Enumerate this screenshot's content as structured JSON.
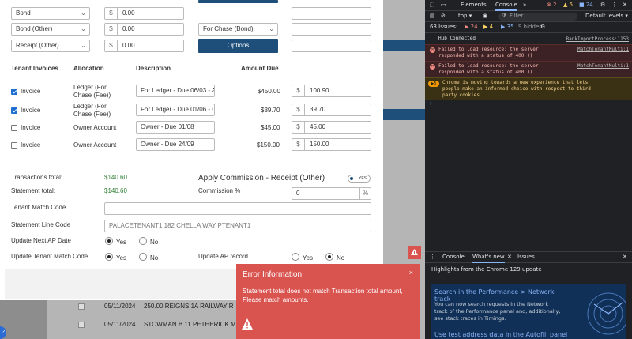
{
  "modal": {
    "top_rows": [
      {
        "select": "Bond",
        "amount": "0.00"
      },
      {
        "select": "Bond (Other)",
        "amount": "0.00",
        "select2": "For Chase (Bond)"
      },
      {
        "select": "Receipt (Other)",
        "amount": "0.00",
        "button": "Options"
      }
    ],
    "currency": "$",
    "headers": {
      "invoices": "Tenant Invoices",
      "allocation": "Allocation",
      "description": "Description",
      "amount": "Amount Due"
    },
    "invoices": [
      {
        "checked": true,
        "label": "Invoice",
        "allocation": "Ledger (For Chase (Fee))",
        "description": "For Ledger - Due 06/03 - A",
        "amount_due": "$450.00",
        "amount": "100.90"
      },
      {
        "checked": true,
        "label": "Invoice",
        "allocation": "Ledger (For Chase (Fee))",
        "description": "For Ledger - Due 01/06 - C",
        "amount_due": "$39.70",
        "amount": "39.70"
      },
      {
        "checked": false,
        "label": "Invoice",
        "allocation": "Owner Account",
        "description": "Owner - Due 01/08",
        "amount_due": "$45.00",
        "amount": "45.00"
      },
      {
        "checked": false,
        "label": "Invoice",
        "allocation": "Owner Account",
        "description": "Owner - Due 24/09",
        "amount_due": "$150.00",
        "amount": "150.00"
      }
    ],
    "transactions_total_label": "Transactions total:",
    "transactions_total": "$140.60",
    "statement_total_label": "Statement total:",
    "statement_total": "$140.60",
    "apply_commission_label": "Apply Commission - Receipt (Other)",
    "toggle_label": "YES",
    "commission_label": "Commission %",
    "commission_value": "0",
    "percent": "%",
    "tenant_match_code_label": "Tenant Match Code",
    "tenant_match_code": "",
    "statement_line_code_label": "Statement Line Code",
    "statement_line_code": "PALACETENANT1  182 CHELLA WAY PTENANT1",
    "update_next_ap_label": "Update Next AP Date",
    "update_tenant_match_label": "Update Tenant Match Code",
    "update_ap_record_label": "Update AP record",
    "yes": "Yes",
    "no": "No"
  },
  "background_rows": [
    {
      "date": "05/11/2024",
      "text": "250.00 REIGNS 1A RAILWAY R"
    },
    {
      "date": "05/11/2024",
      "text": "STOWMAN B 11 PETHERICK MON"
    }
  ],
  "error": {
    "title": "Error Information",
    "close": "×",
    "message": "Statement total does not match Transaction total amount, Please match amounts."
  },
  "help_label": "?",
  "devtools": {
    "tabs": [
      "Elements",
      "Console"
    ],
    "counts": {
      "errors": "2",
      "warnings": "5",
      "messages": "24"
    },
    "context": "top",
    "filter_placeholder": "Filter",
    "levels": "Default levels",
    "issues_label": "63 Issues:",
    "issue_counts": [
      "24",
      "4",
      "35"
    ],
    "hidden": "9 hidden",
    "messages": [
      {
        "type": "info",
        "text": "Hub Connected",
        "link": "BankImportProcess:1153"
      },
      {
        "type": "error",
        "text": "Failed to load resource: the server\nresponded with a status of 400 ()",
        "link": "MatchTenantMulti:1"
      },
      {
        "type": "error",
        "text": "Failed to load resource: the server\nresponded with a status of 400 ()",
        "link": "MatchTenantMulti:1"
      },
      {
        "type": "warning",
        "count": "5",
        "text": "Chrome is moving towards a new experience that lets\npeople make an informed choice with respect to third-\nparty cookies."
      }
    ],
    "drawer_tabs": [
      "Console",
      "What's new",
      "Issues"
    ],
    "drawer_heading": "Highlights from the Chrome 129 update",
    "card1_title": "Search in the Performance > Network track",
    "card1_body": "You can now search requests in the Network track of the Performance panel and, additionally, see stack traces in Timings.",
    "card2_title": "Use test address data in the Autofill panel"
  },
  "colors": {
    "primary": "#1d4f7a",
    "error": "#d9534f",
    "total_green": "#2e7d32"
  }
}
